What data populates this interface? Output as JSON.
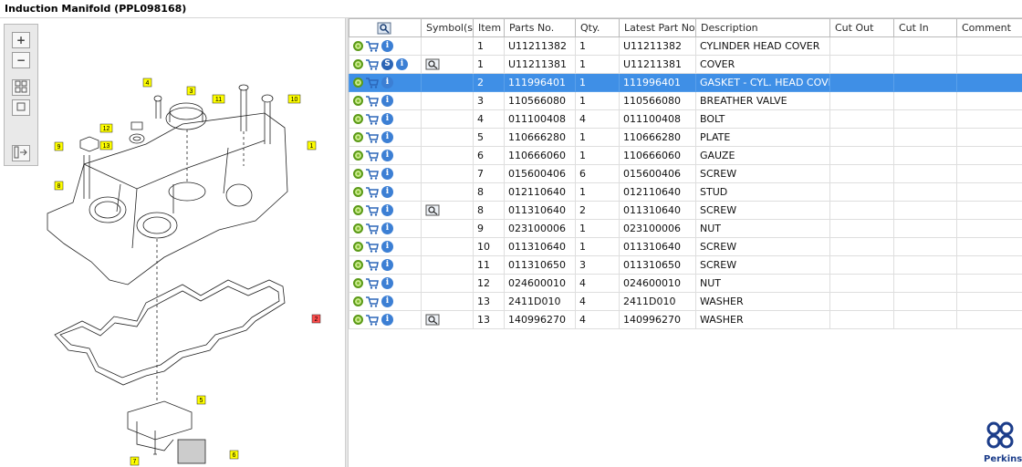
{
  "window": {
    "title": "Induction Manifold (PPL098168)"
  },
  "toolbar": {
    "zoom_in": "+",
    "zoom_out": "−"
  },
  "diagram": {
    "callouts": [
      {
        "num": "1"
      },
      {
        "num": "2"
      },
      {
        "num": "3"
      },
      {
        "num": "4"
      },
      {
        "num": "5"
      },
      {
        "num": "6"
      },
      {
        "num": "7"
      },
      {
        "num": "8"
      },
      {
        "num": "9"
      },
      {
        "num": "10"
      },
      {
        "num": "11"
      },
      {
        "num": "12"
      },
      {
        "num": "13"
      }
    ]
  },
  "table": {
    "headers": {
      "symbols": "Symbol(s)",
      "item": "Item",
      "part_no": "Parts No.",
      "qty": "Qty.",
      "latest": "Latest Part No.",
      "desc": "Description",
      "cut_out": "Cut Out",
      "cut_in": "Cut In",
      "comment": "Comment"
    },
    "rows": [
      {
        "item": "1",
        "part": "U11211382",
        "qty": "1",
        "latest": "U11211382",
        "desc": "CYLINDER HEAD COVER"
      },
      {
        "item": "1",
        "part": "U11211381",
        "qty": "1",
        "latest": "U11211381",
        "desc": "COVER"
      },
      {
        "item": "2",
        "part": "111996401",
        "qty": "1",
        "latest": "111996401",
        "desc": "GASKET - CYL. HEAD COVER"
      },
      {
        "item": "3",
        "part": "110566080",
        "qty": "1",
        "latest": "110566080",
        "desc": "BREATHER VALVE"
      },
      {
        "item": "4",
        "part": "011100408",
        "qty": "4",
        "latest": "011100408",
        "desc": "BOLT"
      },
      {
        "item": "5",
        "part": "110666280",
        "qty": "1",
        "latest": "110666280",
        "desc": "PLATE"
      },
      {
        "item": "6",
        "part": "110666060",
        "qty": "1",
        "latest": "110666060",
        "desc": "GAUZE"
      },
      {
        "item": "7",
        "part": "015600406",
        "qty": "6",
        "latest": "015600406",
        "desc": "SCREW"
      },
      {
        "item": "8",
        "part": "012110640",
        "qty": "1",
        "latest": "012110640",
        "desc": "STUD"
      },
      {
        "item": "8",
        "part": "011310640",
        "qty": "2",
        "latest": "011310640",
        "desc": "SCREW"
      },
      {
        "item": "9",
        "part": "023100006",
        "qty": "1",
        "latest": "023100006",
        "desc": "NUT"
      },
      {
        "item": "10",
        "part": "011310640",
        "qty": "1",
        "latest": "011310640",
        "desc": "SCREW"
      },
      {
        "item": "11",
        "part": "011310650",
        "qty": "3",
        "latest": "011310650",
        "desc": "SCREW"
      },
      {
        "item": "12",
        "part": "024600010",
        "qty": "4",
        "latest": "024600010",
        "desc": "NUT"
      },
      {
        "item": "13",
        "part": "2411D010",
        "qty": "4",
        "latest": "2411D010",
        "desc": "WASHER"
      },
      {
        "item": "13",
        "part": "140996270",
        "qty": "4",
        "latest": "140996270",
        "desc": "WASHER"
      }
    ],
    "selected_row": 2
  },
  "logo": {
    "brand": "Perkins"
  },
  "colors": {
    "selection": "#3f8fe6",
    "callout_yellow": "#ffff00",
    "callout_red": "#ff4d4d"
  }
}
